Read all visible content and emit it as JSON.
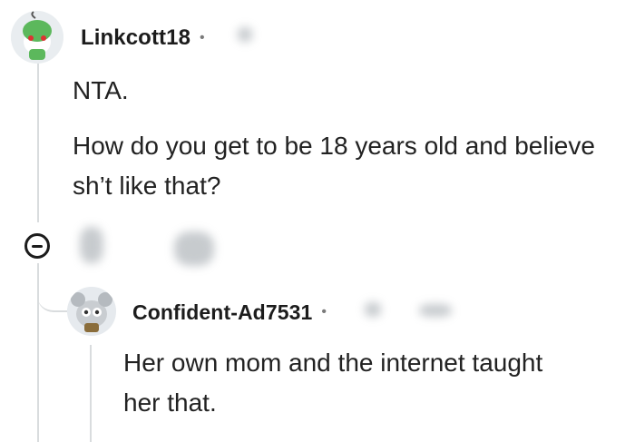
{
  "comments": [
    {
      "username": "Linkcott18",
      "separator": "•",
      "paragraphs": [
        "NTA.",
        "How do you get to be 18 years old and believe sh’t like that?"
      ]
    },
    {
      "username": "Confident-Ad7531",
      "separator": "•",
      "paragraphs": [
        "Her own mom and the internet taught her that."
      ]
    }
  ],
  "icons": {
    "avatar_1": "snoo-avatar-green-hat",
    "avatar_2": "snoo-avatar-gray-mouse",
    "collapse": "collapse-thread-icon"
  },
  "colors": {
    "thread_line": "#d9dcde",
    "text": "#1c1c1c",
    "avatar_green": "#4caf50"
  }
}
